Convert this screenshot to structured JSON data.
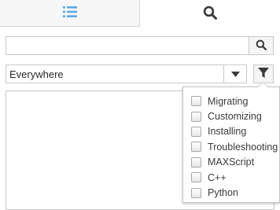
{
  "tabs": [
    {
      "icon": "list-icon",
      "active": false
    },
    {
      "icon": "search-icon",
      "active": true
    }
  ],
  "search": {
    "value": "",
    "placeholder": ""
  },
  "scope": {
    "selected": "Everywhere"
  },
  "filter_menu": {
    "items": [
      {
        "label": "Migrating",
        "checked": false
      },
      {
        "label": "Customizing",
        "checked": false
      },
      {
        "label": "Installing",
        "checked": false
      },
      {
        "label": "Troubleshooting",
        "checked": false
      },
      {
        "label": "MAXScript",
        "checked": false
      },
      {
        "label": "C++",
        "checked": false
      },
      {
        "label": "Python",
        "checked": false
      }
    ]
  },
  "colors": {
    "accent": "#5aa9e6",
    "icon_dark": "#3a3a3a",
    "border": "#c9c9c9"
  }
}
